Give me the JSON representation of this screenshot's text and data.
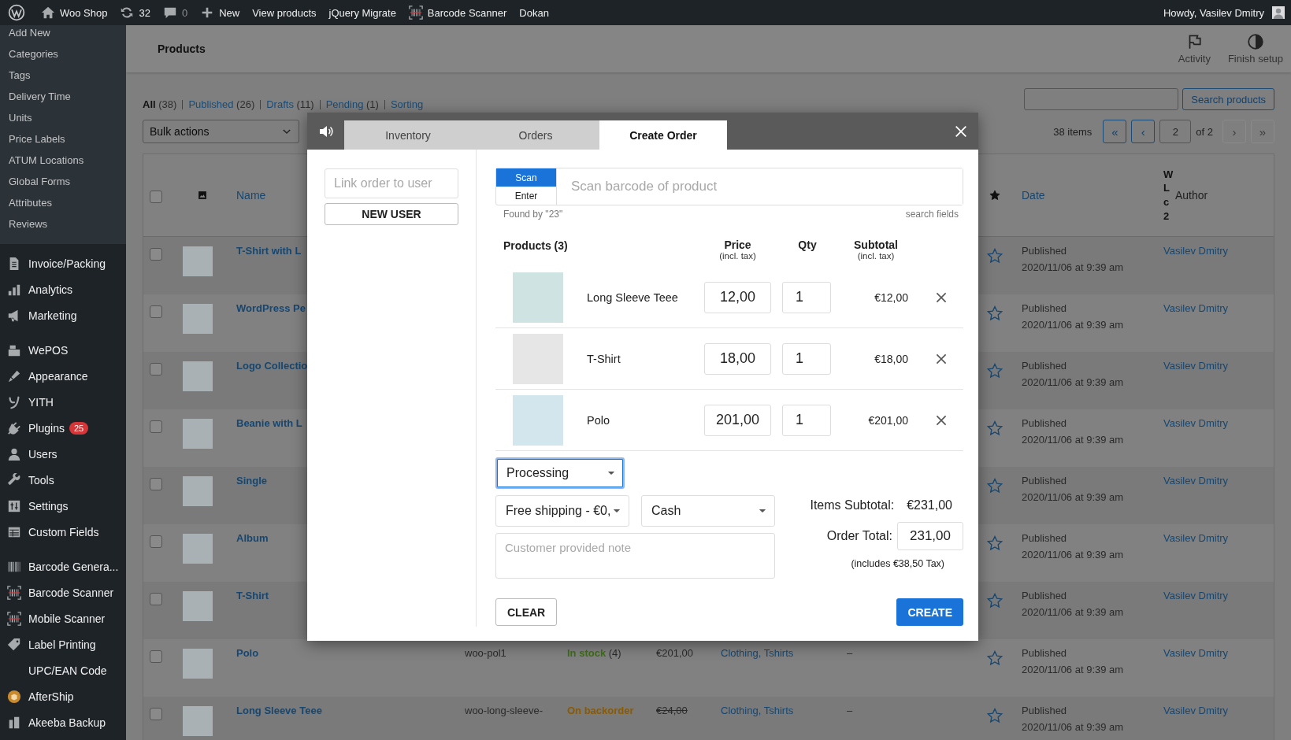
{
  "admin_bar": {
    "items": [
      {
        "label": "Woo Shop"
      },
      {
        "label": "32"
      },
      {
        "label": "0"
      },
      {
        "label": "New"
      },
      {
        "label": "View products"
      },
      {
        "label": "jQuery Migrate"
      },
      {
        "label": "Barcode Scanner"
      },
      {
        "label": "Dokan"
      }
    ],
    "greeting": "Howdy, Vasilev Dmitry"
  },
  "sidebar": {
    "submenu": [
      "Add New",
      "Categories",
      "Tags",
      "Delivery Time",
      "Units",
      "Price Labels",
      "ATUM Locations",
      "Global Forms",
      "Attributes",
      "Reviews"
    ],
    "menu_groups": [
      [
        {
          "label": "Invoice/Packing"
        },
        {
          "label": "Analytics"
        },
        {
          "label": "Marketing"
        }
      ],
      [
        {
          "label": "WePOS"
        },
        {
          "label": "Appearance"
        },
        {
          "label": "YITH"
        },
        {
          "label": "Plugins",
          "badge": "25"
        },
        {
          "label": "Users"
        },
        {
          "label": "Tools"
        },
        {
          "label": "Settings"
        },
        {
          "label": "Custom Fields"
        }
      ],
      [
        {
          "label": "Barcode Genera..."
        },
        {
          "label": "Barcode Scanner"
        },
        {
          "label": "Mobile Scanner"
        },
        {
          "label": "Label Printing"
        },
        {
          "label": "UPC/EAN Code"
        },
        {
          "label": "AfterShip"
        },
        {
          "label": "Akeeba Backup"
        }
      ]
    ]
  },
  "header": {
    "title": "Products",
    "actions": [
      {
        "label": "Activity"
      },
      {
        "label": "Finish setup"
      }
    ]
  },
  "filters": [
    {
      "label": "All",
      "count": "(38)",
      "selected": true
    },
    {
      "label": "Published",
      "count": "(26)",
      "selected": false
    },
    {
      "label": "Drafts",
      "count": "(11)",
      "selected": false
    },
    {
      "label": "Pending",
      "count": "(1)",
      "selected": false
    },
    {
      "label": "Sorting",
      "selected": false
    }
  ],
  "search": {
    "button": "Search products"
  },
  "bulk_actions": {
    "value": "Bulk actions"
  },
  "pagination": {
    "count": "38 items",
    "before": [
      {
        "label": "«",
        "disabled": false
      },
      {
        "label": "‹",
        "disabled": false
      }
    ],
    "page": "2",
    "of": "of 2",
    "after": [
      {
        "label": "›",
        "disabled": true
      },
      {
        "label": "»",
        "disabled": true
      }
    ]
  },
  "table": {
    "select_all": {
      "checked": false
    },
    "columns": {
      "name": "Name",
      "date": "Date",
      "column_11": "WLc2",
      "author": "Author"
    },
    "rows": [
      {
        "name": "T-Shirt with L",
        "checked": false,
        "featured": false,
        "status": "Published",
        "date": "2020/11/06 at 9:39 am",
        "author": "Vasilev Dmitry"
      },
      {
        "name": "WordPress Pe",
        "checked": false,
        "featured": false,
        "status": "Published",
        "date": "2020/11/06 at 9:39 am",
        "author": "Vasilev Dmitry"
      },
      {
        "name": "Logo Collectio",
        "checked": false,
        "featured": false,
        "status": "Published",
        "date": "2020/11/06 at 9:39 am",
        "author": "Vasilev Dmitry"
      },
      {
        "name": "Beanie with L",
        "checked": false,
        "featured": false,
        "status": "Published",
        "date": "2020/11/06 at 9:39 am",
        "author": "Vasilev Dmitry"
      },
      {
        "name": "Single",
        "checked": false,
        "featured": false,
        "status": "Published",
        "date": "2020/11/06 at 9:39 am",
        "author": "Vasilev Dmitry"
      },
      {
        "name": "Album",
        "checked": false,
        "featured": false,
        "status": "Published",
        "date": "2020/11/06 at 9:39 am",
        "author": "Vasilev Dmitry"
      },
      {
        "name": "T-Shirt",
        "checked": false,
        "featured": false,
        "status": "Published",
        "date": "2020/11/06 at 9:39 am",
        "author": "Vasilev Dmitry"
      },
      {
        "name": "Polo",
        "checked": false,
        "featured": false,
        "sku": "woo-pol1",
        "stock": "In stock",
        "in_stock": true,
        "stock_count": "(4)",
        "price": "€201,00",
        "on_sale": false,
        "categories": "Clothing, Tshirts",
        "tags": "–",
        "status": "Published",
        "date": "2020/11/06 at 9:39 am",
        "author": "Vasilev Dmitry"
      },
      {
        "name": "Long Sleeve Teee",
        "checked": false,
        "featured": false,
        "sku": "woo-long-sleeve-",
        "stock": "On backorder",
        "in_stock": false,
        "price": "€24,00",
        "on_sale": true,
        "categories": "Clothing, Tshirts",
        "tags": "–",
        "status": "Published",
        "date": "2020/11/06 at 9:39 am",
        "author": "Vasilev Dmitry"
      }
    ]
  },
  "modal": {
    "tabs": [
      {
        "label": "Inventory",
        "selected": false
      },
      {
        "label": "Orders",
        "selected": false
      },
      {
        "label": "Create Order",
        "selected": true
      }
    ],
    "user_field": {
      "placeholder": "Link order to user"
    },
    "new_user_button": "NEW USER",
    "scan": {
      "modes": [
        {
          "label": "Scan",
          "selected": true
        },
        {
          "label": "Enter",
          "selected": false
        }
      ],
      "placeholder": "Scan barcode of product",
      "found_by": "Found by \"23\"",
      "search_fields": "search fields"
    },
    "products_header": {
      "title": "Products (3)",
      "price": "Price",
      "price_note": "(incl. tax)",
      "qty": "Qty",
      "subtotal": "Subtotal",
      "subtotal_note": "(incl. tax)"
    },
    "products": [
      {
        "name": "Long Sleeve Teee",
        "price": "12,00",
        "qty": "1",
        "subtotal": "€12,00"
      },
      {
        "name": "T-Shirt",
        "price": "18,00",
        "qty": "1",
        "subtotal": "€18,00"
      },
      {
        "name": "Polo",
        "price": "201,00",
        "qty": "1",
        "subtotal": "€201,00"
      }
    ],
    "status": {
      "value": "Processing",
      "focused": true
    },
    "shipping": {
      "value": "Free shipping - €0,"
    },
    "payment": {
      "value": "Cash"
    },
    "note": {
      "placeholder": "Customer provided note"
    },
    "items_subtotal": {
      "label": "Items Subtotal:",
      "value": "€231,00"
    },
    "order_total": {
      "label": "Order Total:",
      "value": "231,00"
    },
    "tax_note": "(includes €38,50 Tax)",
    "clear_button": "CLEAR",
    "create_button": "CREATE"
  }
}
